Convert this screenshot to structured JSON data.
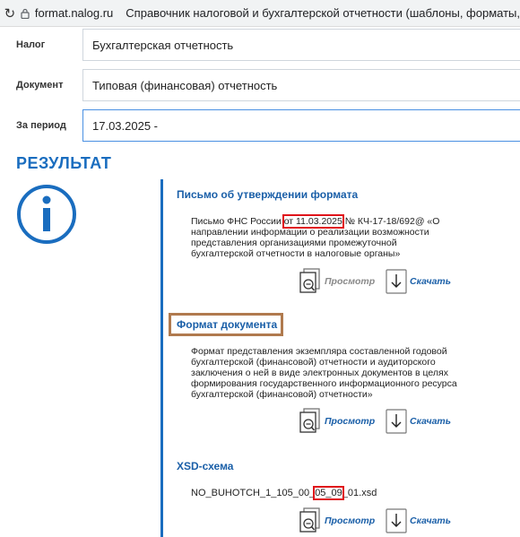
{
  "browser": {
    "domain": "format.nalog.ru",
    "page_title": "Справочник налоговой и бухгалтерской отчетности (шаблоны, форматы,"
  },
  "form": {
    "tax_label": "Налог",
    "tax_value": "Бухгалтерская отчетность",
    "document_label": "Документ",
    "document_value": "Типовая (финансовая) отчетность",
    "period_label": "За период",
    "period_value": "17.03.2025 -"
  },
  "result": {
    "heading": "РЕЗУЛЬТАТ",
    "sections": [
      {
        "title": "Письмо об утверждении формата",
        "desc_before": "Письмо ФНС России ",
        "desc_highlight": "от 11.03.2025",
        "desc_after": " № КЧ-17-18/692@ «О направлении информации о реализации возможности представления организациями промежуточной бухгалтерской отчетности в налоговые органы»",
        "view_label": "Просмотр",
        "download_label": "Скачать"
      },
      {
        "title": "Формат документа",
        "desc": "Формат представления экземпляра составленной годовой бухгалтерской (финансовой) отчетности и аудиторского заключения о ней в виде электронных документов в целях формирования государственного информационного ресурса бухгалтерской (финансовой) отчетности»",
        "view_label": "Просмотр",
        "download_label": "Скачать"
      },
      {
        "title": "XSD-схема",
        "file_before": "NO_BUHOTCH_1_105_00_",
        "file_highlight": "05_09",
        "file_after": "_01.xsd",
        "view_label": "Просмотр",
        "download_label": "Скачать"
      }
    ]
  },
  "colors": {
    "accent_blue": "#1a6dbf",
    "highlight_red": "#e0141b",
    "highlight_brown": "#b07a4e",
    "disabled_gray": "#8a8a8a"
  }
}
